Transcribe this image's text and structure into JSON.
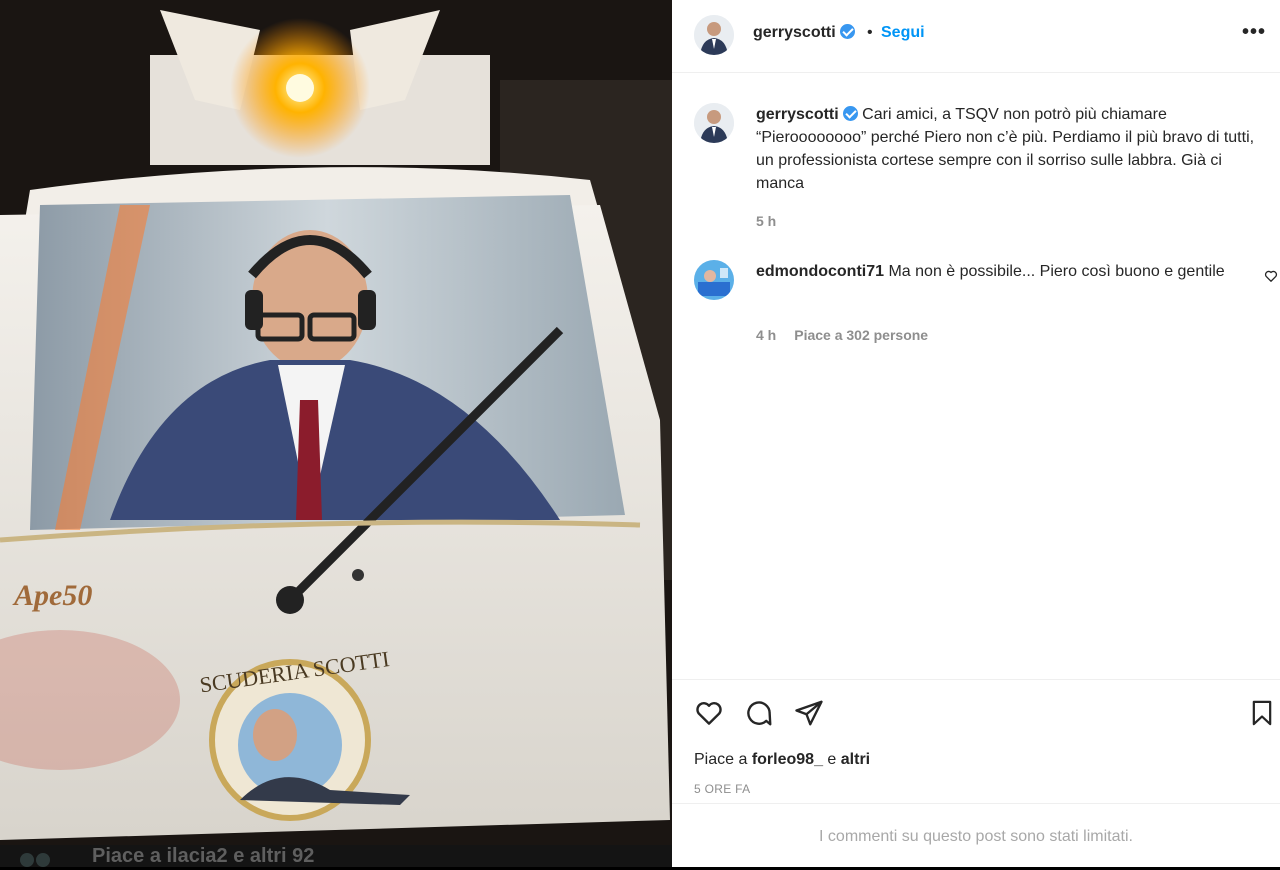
{
  "post": {
    "author": "gerryscotti",
    "follow_label": "Segui",
    "separator": "•",
    "more_label": "•••",
    "caption_text": "Cari amici, a TSQV non potrò più chiamare “Pieroooooooo” perché Piero non c’è più. Perdiamo il più bravo di tutti, un professionista cortese sempre con il sorriso sulle labbra. Già ci manca",
    "caption_time": "5 h"
  },
  "comment": {
    "user": "edmondoconti71",
    "text": "Ma non è possibile... Piero così buono e gentile",
    "time": "4 h",
    "likes": "Piace a 302 persone"
  },
  "actions": {
    "like_icon": "heart-icon",
    "comment_icon": "comment-icon",
    "share_icon": "send-icon",
    "save_icon": "bookmark-icon"
  },
  "likes": {
    "prefix": "Piace a",
    "user": "forleo98_",
    "middle": "e",
    "suffix": "altri"
  },
  "timestamp": "5 ORE FA",
  "comments_limited": "I commenti su questo post sono stati limitati.",
  "photo": {
    "vehicle_logo": "Ape50",
    "badge_text": "SCUDERIA SCOTTI",
    "overlay_caption": "Piace a ilacia2 e altri 92"
  },
  "colors": {
    "link_blue": "#0095f6",
    "verified_blue": "#3897f0",
    "muted": "#8e8e8e"
  }
}
